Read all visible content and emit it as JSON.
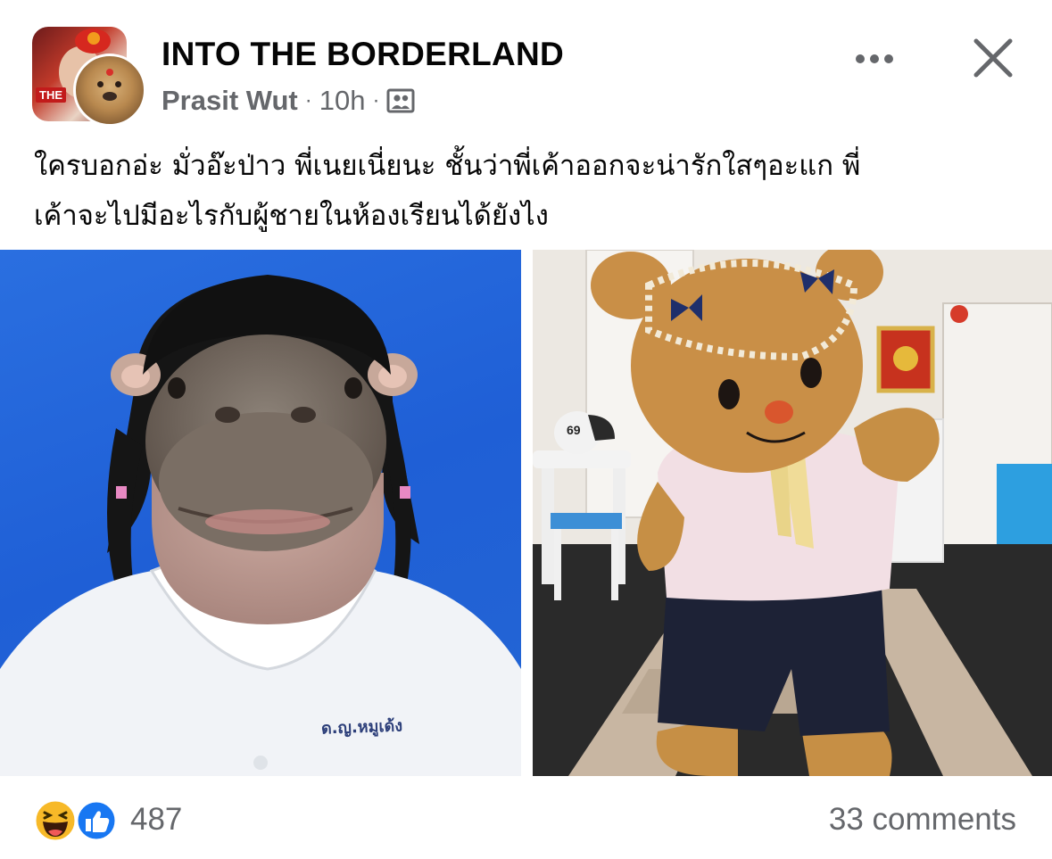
{
  "post": {
    "page_name": "INTO THE BORDERLAND",
    "author": "Prasit Wut",
    "separator": "·",
    "time": "10h",
    "audience_icon": "group-audience-icon",
    "avatar_tag": "THE",
    "caption_lines": [
      "ใครบอกอ่ะ มั่วอ๊ะป่าว พี่เนยเนี่ยนะ ชั้นว่าพี่เค้าออกจะน่ารักใสๆอะแก พี่",
      "เค้าจะไปมีอะไรกับผู้ชายในห้องเรียนได้ยังไง"
    ]
  },
  "photos": {
    "left": {
      "name_tag": "ด.ญ.หมูเด้ง"
    },
    "right": {
      "helmet_number": "69"
    }
  },
  "footer": {
    "reactions": [
      "haha-reaction-icon",
      "like-reaction-icon"
    ],
    "reaction_count": "487",
    "comments": "33 comments"
  },
  "colors": {
    "secondary_text": "#65676b",
    "like_blue": "#1877f2",
    "photo_blue": "#2466d4"
  }
}
